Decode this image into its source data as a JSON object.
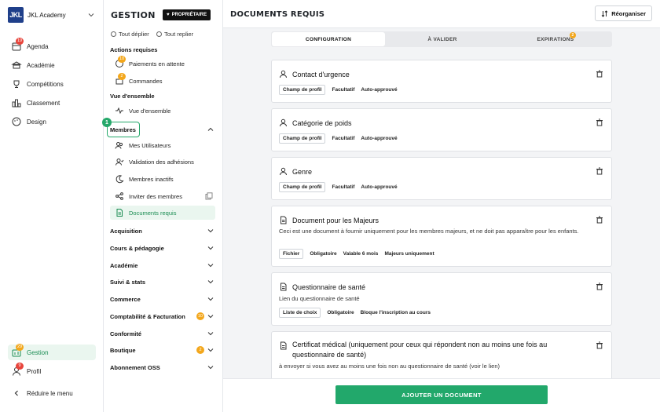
{
  "app": {
    "logo_text": "JKL",
    "academy_name": "JKL Academy"
  },
  "rail": {
    "items": [
      {
        "label": "Agenda",
        "icon": "calendar-icon",
        "badge": "19"
      },
      {
        "label": "Académie",
        "icon": "academy-icon"
      },
      {
        "label": "Compétitions",
        "icon": "trophy-icon"
      },
      {
        "label": "Classement",
        "icon": "ranking-icon"
      },
      {
        "label": "Design",
        "icon": "palette-icon"
      }
    ],
    "bottom": [
      {
        "label": "Gestion",
        "icon": "gestion-icon",
        "badge": "29"
      },
      {
        "label": "Profil",
        "icon": "profile-icon",
        "badge": "9"
      }
    ],
    "collapse_label": "Réduire le menu"
  },
  "panel": {
    "title": "GESTION",
    "owner_badge": "PROPRIÉTAIRE",
    "expand_all": "Tout déplier",
    "collapse_all": "Tout replier",
    "actions_head": "Actions requises",
    "actions": [
      {
        "label": "Paiements en attente",
        "badge": "10"
      },
      {
        "label": "Commandes",
        "badge": "2"
      }
    ],
    "overview_head": "Vue d'ensemble",
    "overview_item": "Vue d'ensemble",
    "members_head": "Membres",
    "step_number": "1",
    "members": [
      "Mes Utilisateurs",
      "Validation des adhésions",
      "Membres inactifs",
      "Inviter des membres",
      "Documents requis"
    ],
    "sections": [
      {
        "label": "Acquisition"
      },
      {
        "label": "Cours & pédagogie"
      },
      {
        "label": "Académie"
      },
      {
        "label": "Suivi & stats"
      },
      {
        "label": "Commerce"
      },
      {
        "label": "Comptabilité & Facturation",
        "badge": "10"
      },
      {
        "label": "Conformité"
      },
      {
        "label": "Boutique",
        "badge": "2"
      },
      {
        "label": "Abonnement OSS"
      }
    ]
  },
  "main": {
    "title": "DOCUMENTS REQUIS",
    "reorganize": "Réorganiser",
    "tabs": [
      {
        "label": "CONFIGURATION"
      },
      {
        "label": "À VALIDER"
      },
      {
        "label": "EXPIRATIONS",
        "badge": "2"
      }
    ],
    "cards": [
      {
        "title": "Contact d'urgence",
        "icon": "person-icon",
        "desc": "",
        "tags": [
          "Champ de profil",
          "Facultatif",
          "Auto-approuvé"
        ]
      },
      {
        "title": "Catégorie de poids",
        "icon": "person-icon",
        "desc": "",
        "tags": [
          "Champ de profil",
          "Facultatif",
          "Auto-approuvé"
        ]
      },
      {
        "title": "Genre",
        "icon": "person-icon",
        "desc": "",
        "tags": [
          "Champ de profil",
          "Facultatif",
          "Auto-approuvé"
        ]
      },
      {
        "title": "Document pour les Majeurs",
        "icon": "document-icon",
        "desc": "Ceci est une document à fournir uniquement pour les membres majeurs, et ne doit pas apparaître pour les enfants.",
        "tags": [
          "Fichier",
          "Obligatoire",
          "Valable 6 mois",
          "Majeurs uniquement"
        ]
      },
      {
        "title": "Questionnaire de santé",
        "icon": "document-icon",
        "desc": "Lien du questionnaire de santé",
        "tags": [
          "Liste de choix",
          "Obligatoire",
          "Bloque l'inscription au cours"
        ]
      },
      {
        "title": "Certificat médical (uniquement pour ceux qui répondent non au moins une fois au questionnaire de santé)",
        "icon": "document-icon",
        "desc": "à envoyer si vous avez au moins une fois non au questionnaire de santé (voir le lien)",
        "tags": []
      }
    ],
    "add_button": "AJOUTER UN DOCUMENT"
  }
}
